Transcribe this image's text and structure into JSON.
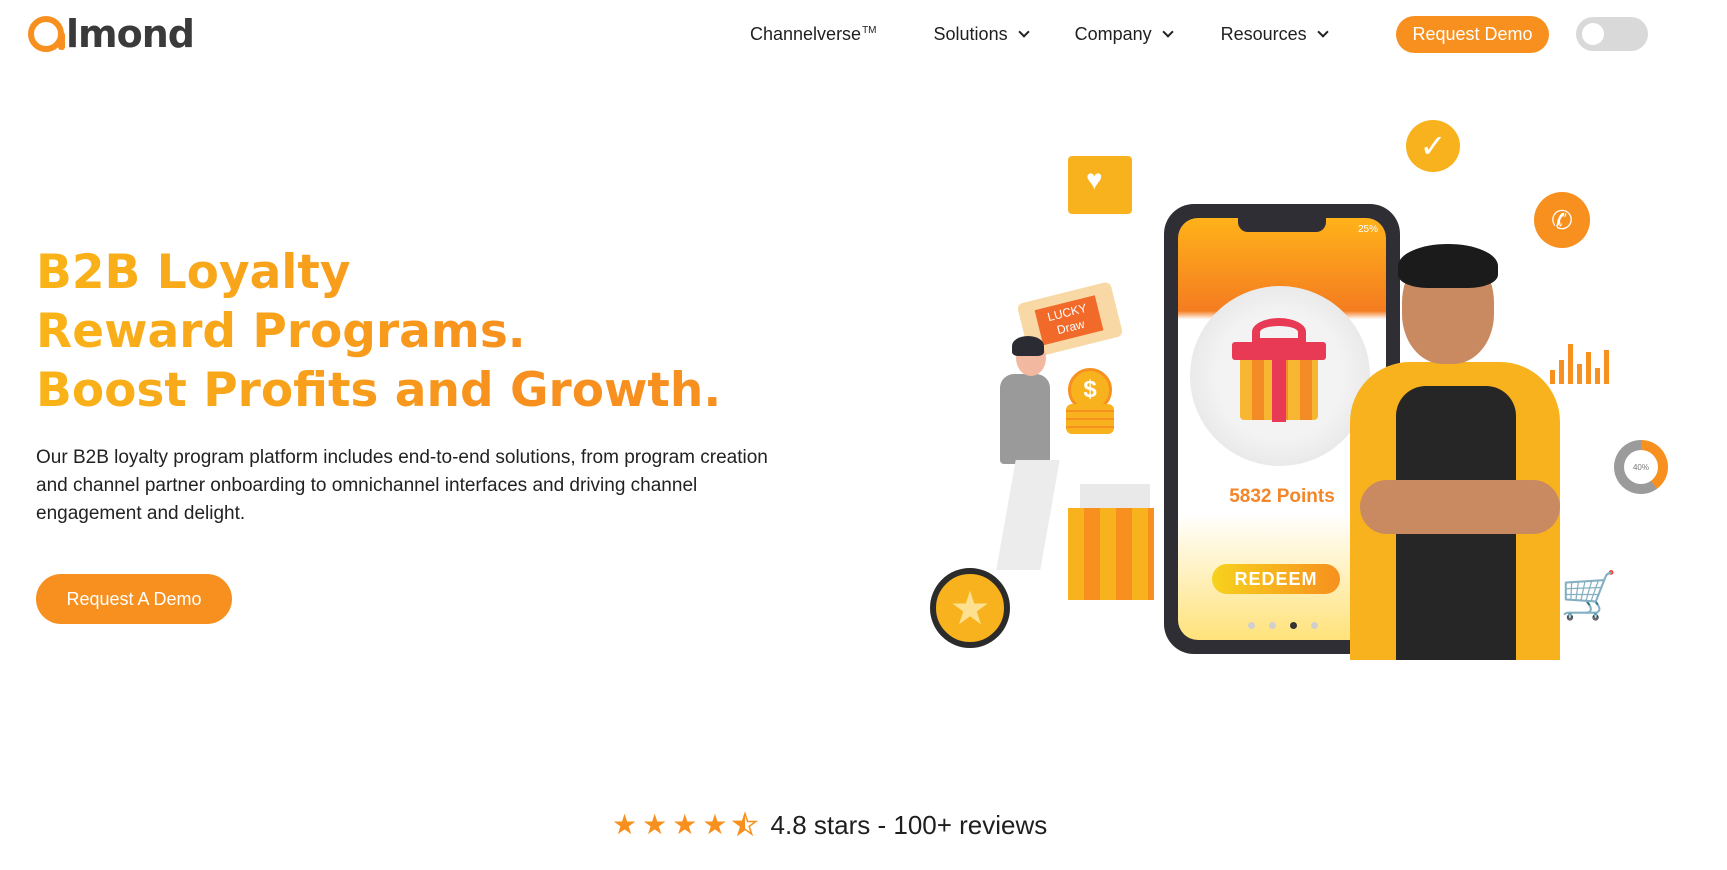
{
  "brand": {
    "logo_text": "lmond"
  },
  "nav": {
    "items": [
      {
        "label": "Channelverse",
        "sup": "TM",
        "has_dropdown": false
      },
      {
        "label": "Solutions",
        "has_dropdown": true
      },
      {
        "label": "Company",
        "has_dropdown": true
      },
      {
        "label": "Resources",
        "has_dropdown": true
      }
    ],
    "demo_button": "Request Demo",
    "theme_toggle": {
      "state": "off"
    }
  },
  "hero": {
    "title_lines": [
      "B2B Loyalty",
      "Reward Programs.",
      "Boost Profits and Growth."
    ],
    "description": "Our B2B loyalty program platform includes end-to-end solutions, from program creation and channel partner onboarding to omnichannel interfaces and driving channel engagement and delight.",
    "cta": "Request A Demo"
  },
  "illustration": {
    "phone": {
      "status": "25%",
      "points": "5832 Points",
      "redeem": "REDEEM",
      "carousel_dots": 4,
      "active_dot": 3
    },
    "lucky_ticket": "LUCKY Draw",
    "coin_symbol": "$",
    "donut_label": "40%",
    "icons": [
      "envelope-heart-icon",
      "check-bubble-icon",
      "whatsapp-icon",
      "bar-chart-icon",
      "donut-chart-icon",
      "shopping-cart-icon",
      "star-badge-icon",
      "gift-icon"
    ]
  },
  "reviews": {
    "rating": 4.5,
    "text": "4.8 stars - 100+ reviews"
  },
  "colors": {
    "accent": "#f7901e",
    "accent_light": "#f9b418",
    "text": "#1f1f1f",
    "toggle": "#d9d9d9"
  }
}
